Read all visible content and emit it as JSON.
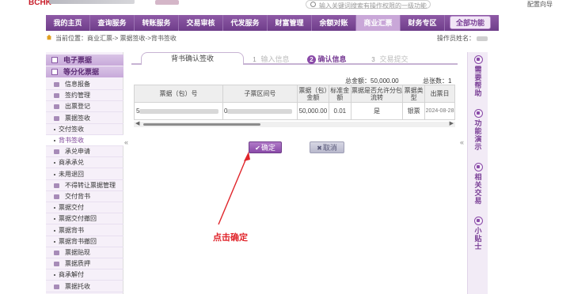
{
  "header": {
    "logo_mark": "BCHK",
    "search_placeholder": "输入关键词搜索有操作权限的一级功能",
    "help": "配置向导"
  },
  "nav": {
    "items": [
      "我的主页",
      "查询服务",
      "转账服务",
      "交易审核",
      "代发服务",
      "财富管理",
      "余额对账",
      "商业汇票",
      "财务专区"
    ],
    "active_index": 7,
    "full_menu": "全部功能"
  },
  "breadcrumb": {
    "text": "当前位置：商业汇票-> 票据签收->背书签收",
    "operator_label": "操作员姓名："
  },
  "sidebar": {
    "headers": [
      "电子票据",
      "等分化票据"
    ],
    "items": [
      {
        "label": "信息报备",
        "type": "item"
      },
      {
        "label": "签约管理",
        "type": "item"
      },
      {
        "label": "出票登记",
        "type": "item"
      },
      {
        "label": "票据签收",
        "type": "item"
      },
      {
        "label": "交付签收",
        "type": "sub"
      },
      {
        "label": "背书签收",
        "type": "sub",
        "active": true
      },
      {
        "label": "承兑申请",
        "type": "item"
      },
      {
        "label": "商承承兑",
        "type": "sub"
      },
      {
        "label": "未用退回",
        "type": "sub"
      },
      {
        "label": "不得转让票据管理",
        "type": "item"
      },
      {
        "label": "交付背书",
        "type": "item"
      },
      {
        "label": "票据交付",
        "type": "sub"
      },
      {
        "label": "票据交付撤回",
        "type": "sub"
      },
      {
        "label": "票据背书",
        "type": "sub"
      },
      {
        "label": "票据背书撤回",
        "type": "sub"
      },
      {
        "label": "票据贴现",
        "type": "item"
      },
      {
        "label": "票据质押",
        "type": "item"
      },
      {
        "label": "商承解付",
        "type": "sub"
      },
      {
        "label": "票据托收",
        "type": "item"
      }
    ]
  },
  "main": {
    "tab_title": "背书确认签收",
    "steps": [
      {
        "num": "1",
        "label": "输入信息",
        "state": "done"
      },
      {
        "num": "2",
        "label": "确认信息",
        "state": "active"
      },
      {
        "num": "3",
        "label": "交易提交",
        "state": "pending"
      }
    ],
    "total_amount_label": "总金额：",
    "total_amount": "50,000.00",
    "count_label": "总张数：",
    "count": "1",
    "table": {
      "headers": [
        "票据（包）号",
        "子票区间号",
        "票据（包）金额",
        "标准金额",
        "票据是否允许分包流转",
        "票据类型",
        "出票日"
      ],
      "rows": [
        [
          "5",
          "0",
          "50,000.00",
          "0.01",
          "是",
          "银票",
          "2024-08-28"
        ]
      ]
    },
    "ok_button": "确定",
    "cancel_button": "取消",
    "annotation": "点击确定"
  },
  "rail": [
    {
      "label": "需要帮助"
    },
    {
      "label": "功能演示"
    },
    {
      "label": "相关交易"
    },
    {
      "label": "小贴士"
    }
  ],
  "colors": {
    "brand_purple": "#7a3f96",
    "annotation_red": "#e0242a"
  }
}
